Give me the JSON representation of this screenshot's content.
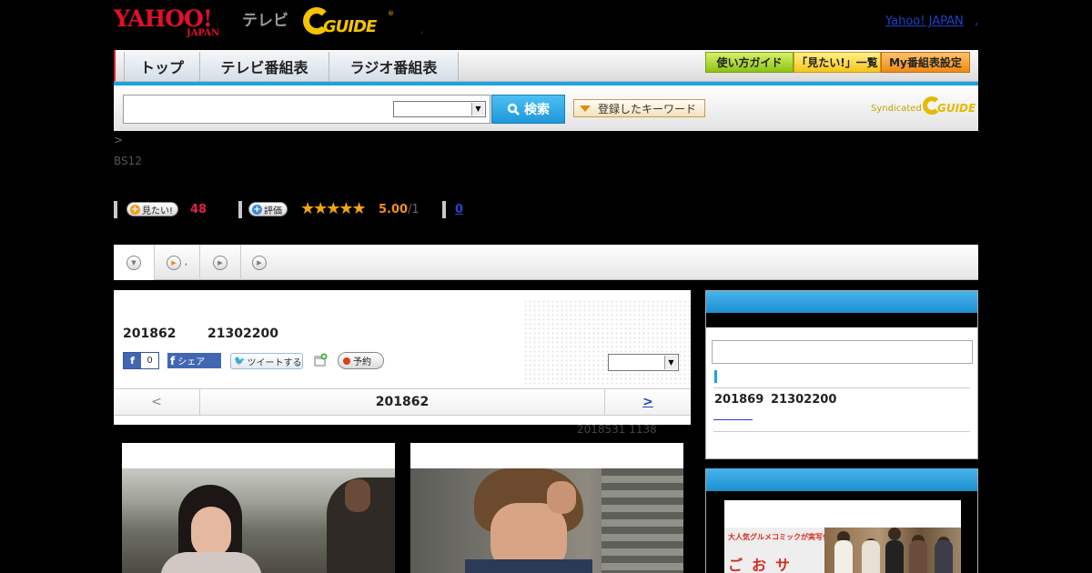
{
  "header": {
    "yahoo_logo": "YAHOO!",
    "japan": "JAPAN",
    "tv": "テレビ",
    "gguide": "GUIDE",
    "registered": "®",
    "dot": ",",
    "yahoo_japan_link": "Yahoo! JAPAN",
    "link_dot": ","
  },
  "nav": {
    "tabs": [
      "トップ",
      "テレビ番組表",
      "ラジオ番組表"
    ],
    "buttons": [
      "使い方ガイド",
      "「見たい!」一覧",
      "My番組表設定"
    ]
  },
  "search": {
    "button_label": "検索",
    "keyword_button": "登録したキーワード",
    "syndicated": "Syndicated",
    "gguide_small": "GUIDE"
  },
  "breadcrumb": ">",
  "channel": "BS12",
  "stats": {
    "want_label": "見たい!",
    "want_count": "48",
    "rate_label": "評価",
    "stars": "★★★★★",
    "rating": "5.00",
    "rating_den": "/1",
    "comment_count": "0"
  },
  "program_tabs": {
    "tab2_dot": ","
  },
  "program": {
    "date": "201862",
    "time": "21302200",
    "fb_like": "0",
    "fb_f": "f",
    "fb_share": "シェア",
    "tweet": "ツイートする",
    "reserve": "予約",
    "pager_prev": "<",
    "pager_center": "201862",
    "pager_next": ">",
    "updated": "2018531  1138"
  },
  "sidebar": {
    "next_date": "201869",
    "next_time": "21302200"
  },
  "banner": {
    "tagline": "大人気グルメコミックが実写化!",
    "title": "ごおサ"
  }
}
